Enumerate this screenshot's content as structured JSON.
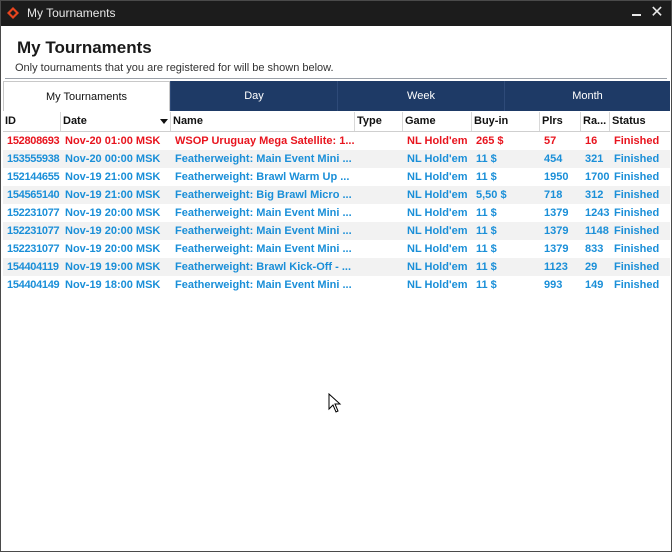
{
  "window": {
    "title": "My Tournaments",
    "minimize_label": "_",
    "close_label": "✕"
  },
  "header": {
    "title": "My Tournaments",
    "subtitle": "Only tournaments that you are registered for will be shown below."
  },
  "tabs": [
    {
      "label": "My Tournaments",
      "active": true
    },
    {
      "label": "Day",
      "active": false
    },
    {
      "label": "Week",
      "active": false
    },
    {
      "label": "Month",
      "active": false
    }
  ],
  "columns": [
    "ID",
    "Date",
    "Name",
    "Type",
    "Game",
    "Buy-in",
    "Plrs",
    "Ra...",
    "Status"
  ],
  "colors": {
    "highlight_row": "#e8141e",
    "normal_row": "#1a8fd8",
    "tab_bar": "#1e3a66"
  },
  "rows": [
    {
      "id": "152808693",
      "date": "Nov-20 01:00 MSK",
      "name": "WSOP Uruguay Mega Satellite: 1...",
      "type": "",
      "game": "NL Hold'em",
      "buyin": "265 $",
      "plrs": "57",
      "rank": "16",
      "status": "Finished",
      "highlight": true
    },
    {
      "id": "153555938",
      "date": "Nov-20 00:00 MSK",
      "name": "Featherweight: Main Event Mini ...",
      "type": "",
      "game": "NL Hold'em",
      "buyin": "11 $",
      "plrs": "454",
      "rank": "321",
      "status": "Finished",
      "highlight": false
    },
    {
      "id": "152144655",
      "date": "Nov-19 21:00 MSK",
      "name": "Featherweight: Brawl Warm Up ...",
      "type": "",
      "game": "NL Hold'em",
      "buyin": "11 $",
      "plrs": "1950",
      "rank": "1700",
      "status": "Finished",
      "highlight": false
    },
    {
      "id": "154565140",
      "date": "Nov-19 21:00 MSK",
      "name": "Featherweight: Big Brawl Micro ...",
      "type": "",
      "game": "NL Hold'em",
      "buyin": "5,50 $",
      "plrs": "718",
      "rank": "312",
      "status": "Finished",
      "highlight": false
    },
    {
      "id": "152231077",
      "date": "Nov-19 20:00 MSK",
      "name": "Featherweight: Main Event Mini ...",
      "type": "",
      "game": "NL Hold'em",
      "buyin": "11 $",
      "plrs": "1379",
      "rank": "1243",
      "status": "Finished",
      "highlight": false
    },
    {
      "id": "152231077",
      "date": "Nov-19 20:00 MSK",
      "name": "Featherweight: Main Event Mini ...",
      "type": "",
      "game": "NL Hold'em",
      "buyin": "11 $",
      "plrs": "1379",
      "rank": "1148",
      "status": "Finished",
      "highlight": false
    },
    {
      "id": "152231077",
      "date": "Nov-19 20:00 MSK",
      "name": "Featherweight: Main Event Mini ...",
      "type": "",
      "game": "NL Hold'em",
      "buyin": "11 $",
      "plrs": "1379",
      "rank": "833",
      "status": "Finished",
      "highlight": false
    },
    {
      "id": "154404119",
      "date": "Nov-19 19:00 MSK",
      "name": "Featherweight: Brawl Kick-Off - ...",
      "type": "",
      "game": "NL Hold'em",
      "buyin": "11 $",
      "plrs": "1123",
      "rank": "29",
      "status": "Finished",
      "highlight": false
    },
    {
      "id": "154404149",
      "date": "Nov-19 18:00 MSK",
      "name": "Featherweight: Main Event Mini ...",
      "type": "",
      "game": "NL Hold'em",
      "buyin": "11 $",
      "plrs": "993",
      "rank": "149",
      "status": "Finished",
      "highlight": false
    }
  ]
}
